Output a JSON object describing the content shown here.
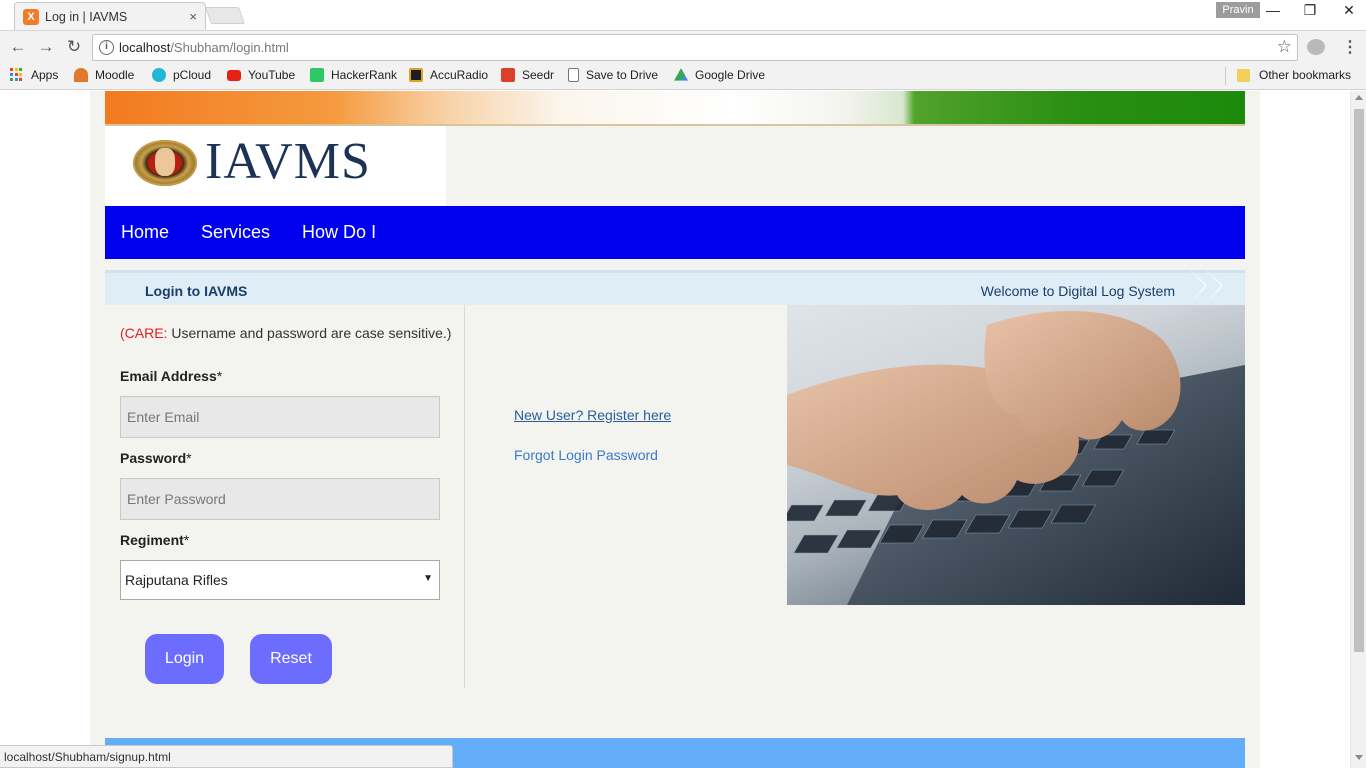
{
  "browser": {
    "tab_title": "Log in | IAVMS",
    "tab_close": "×",
    "favicon_glyph": "X",
    "profile_name": "Pravin",
    "url_host": "localhost",
    "url_path": "/Shubham/login.html",
    "win_min": "—",
    "win_restore": "❐",
    "win_close": "✕",
    "back": "←",
    "forward": "→",
    "reload": "↻",
    "star": "☆",
    "menu": "⋮"
  },
  "bookmarks": [
    {
      "label": "Apps"
    },
    {
      "label": "Moodle",
      "color": "#e07a2a"
    },
    {
      "label": "pCloud",
      "color": "#20b7d8"
    },
    {
      "label": "YouTube",
      "color": "#e62117"
    },
    {
      "label": "HackerRank",
      "color": "#2ec866"
    },
    {
      "label": "AccuRadio",
      "color": "#1e1e1e"
    },
    {
      "label": "Seedr",
      "color": "#d9412b"
    },
    {
      "label": "Save to Drive",
      "color": "#ffffff"
    },
    {
      "label": "Google Drive",
      "color": "#1fa463"
    }
  ],
  "other_bookmarks": "Other bookmarks",
  "site": {
    "logo_text": "IAVMS",
    "nav": [
      "Home",
      "Services",
      "How Do I"
    ],
    "login_title": "Login to IAVMS",
    "welcome": "Welcome to Digital Log System",
    "care_prefix": "(CARE:",
    "care_text": " Username and password are case sensitive.)",
    "email_label": "Email Address",
    "email_placeholder": "Enter Email",
    "password_label": "Password",
    "password_placeholder": "Enter Password",
    "regiment_label": "Regiment",
    "required_mark": "*",
    "regiment_value": "Rajputana Rifles",
    "login_button": "Login",
    "reset_button": "Reset",
    "register_link": "New User? Register here ",
    "forgot_link": "Forgot Login Password",
    "accent_nav": "#0000ee",
    "accent_button": "#6c6cff",
    "footer_color": "#64adf9"
  },
  "status_url": "localhost/Shubham/signup.html"
}
